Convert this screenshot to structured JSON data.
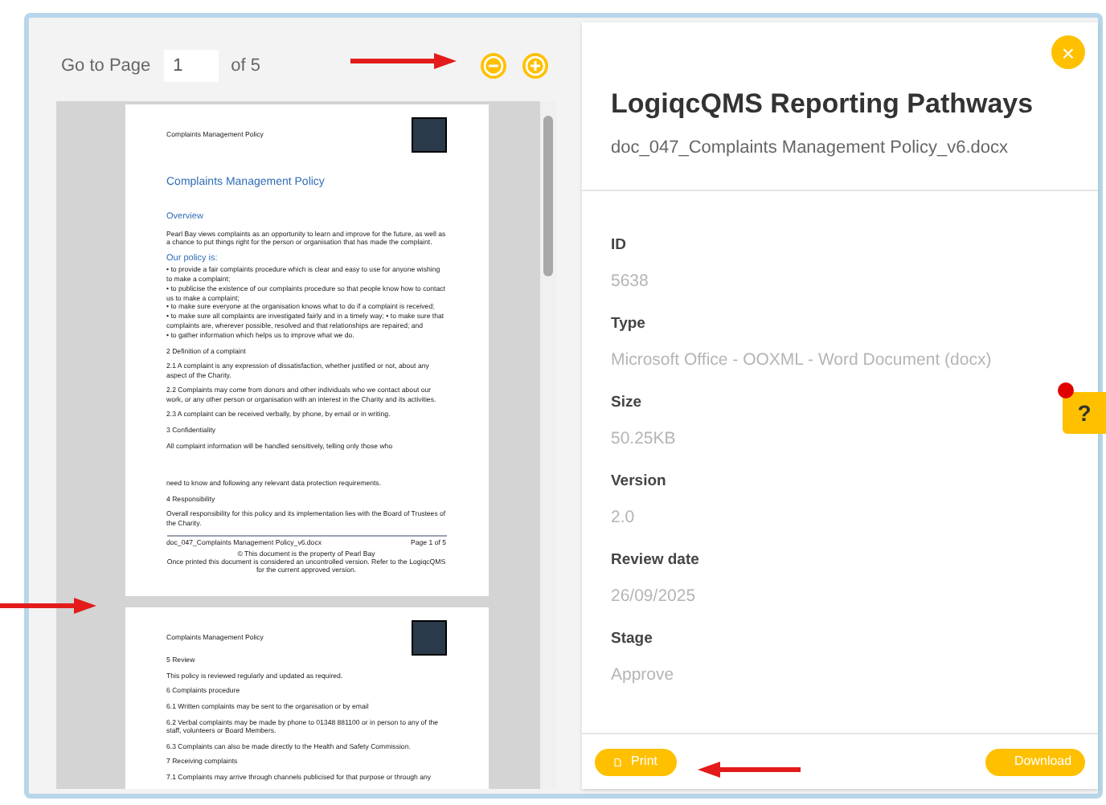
{
  "viewer": {
    "goto_label": "Go to Page",
    "page_input": "1",
    "page_count": "of 5",
    "pages": [
      {
        "header": "Complaints Management Policy",
        "blocks": [
          {
            "kind": "title",
            "text": "Complaints Management Policy"
          },
          {
            "kind": "heading",
            "text": "Overview"
          },
          {
            "kind": "para",
            "text": "Pearl Bay views complaints as an opportunity to learn and improve for the future, as well as a chance to put things right for the person or organisation that has made the complaint."
          },
          {
            "kind": "heading",
            "text": "Our policy is:"
          },
          {
            "kind": "line",
            "text": "• to provide a fair complaints procedure which is clear and easy to use for anyone wishing to make a complaint;"
          },
          {
            "kind": "line",
            "text": "• to publicise the existence of our complaints procedure so that people know how to contact us to make a complaint;"
          },
          {
            "kind": "line",
            "text": "• to make sure everyone at the organisation knows what to do if a complaint is received;"
          },
          {
            "kind": "line",
            "text": "• to make sure all complaints are investigated fairly and in a timely way; • to make sure that complaints are, wherever possible, resolved and that relationships are repaired; and"
          },
          {
            "kind": "line",
            "text": "• to gather information which helps us to improve what we do."
          },
          {
            "kind": "para",
            "text": "2 Definition of a complaint"
          },
          {
            "kind": "para",
            "text": "2.1     A complaint is any expression of dissatisfaction, whether justified or not, about any aspect of the Charity."
          },
          {
            "kind": "para",
            "text": "2.2     Complaints may come from donors and other individuals who we contact about our work, or any other person or organisation with an interest in the Charity and its activities."
          },
          {
            "kind": "para",
            "text": "2.3     A complaint can be received verbally, by phone, by email or in writing."
          },
          {
            "kind": "para",
            "text": "3       Confidentiality"
          },
          {
            "kind": "para",
            "text": "All complaint information will be handled sensitively, telling only those who"
          },
          {
            "kind": "gap"
          },
          {
            "kind": "para",
            "text": "need to know and following any relevant data protection requirements."
          },
          {
            "kind": "para",
            "text": "4       Responsibility"
          },
          {
            "kind": "para",
            "text": "Overall responsibility for this policy and its implementation lies with the Board of Trustees of the Charity."
          }
        ],
        "footer": {
          "file": "doc_047_Complaints Management Policy_v6.docx",
          "page": "Page 1 of 5",
          "notes": [
            "© This document is the property of Pearl Bay",
            "Once printed this document is considered an uncontrolled version. Refer to the LogiqcQMS for the current approved version."
          ]
        }
      },
      {
        "header": "Complaints Management Policy",
        "blocks": [
          {
            "kind": "line",
            "text": "5       Review"
          },
          {
            "kind": "para",
            "text": "This policy is reviewed regularly and updated as required."
          },
          {
            "kind": "para",
            "text": "6       Complaints procedure"
          },
          {
            "kind": "para",
            "text": "6.1     Written complaints may be sent to the organisation or by email"
          },
          {
            "kind": "para",
            "text": "6.2     Verbal complaints may be made by phone to 01348 881100 or in person to any of the staff, volunteers or Board Members."
          },
          {
            "kind": "para",
            "text": "6.3     Complaints can also be made directly to the Health and Safety Commission."
          },
          {
            "kind": "para",
            "text": "7       Receiving complaints"
          },
          {
            "kind": "para",
            "text": "7.1 Complaints may arrive through channels publicised for that purpose or through any"
          }
        ]
      }
    ]
  },
  "details": {
    "title": "LogiqcQMS Reporting Pathways",
    "filename": "doc_047_Complaints Management Policy_v6.docx",
    "fields": [
      {
        "label": "ID",
        "value": "5638"
      },
      {
        "label": "Type",
        "value": "Microsoft Office - OOXML - Word Document (docx)"
      },
      {
        "label": "Size",
        "value": "50.25KB"
      },
      {
        "label": "Version",
        "value": "2.0"
      },
      {
        "label": "Review date",
        "value": "26/09/2025"
      },
      {
        "label": "Stage",
        "value": "Approve"
      }
    ],
    "close": "×",
    "help": "?",
    "buttons": [
      {
        "kind": "print",
        "label": "Print"
      },
      {
        "kind": "download",
        "label": "Download"
      }
    ]
  }
}
